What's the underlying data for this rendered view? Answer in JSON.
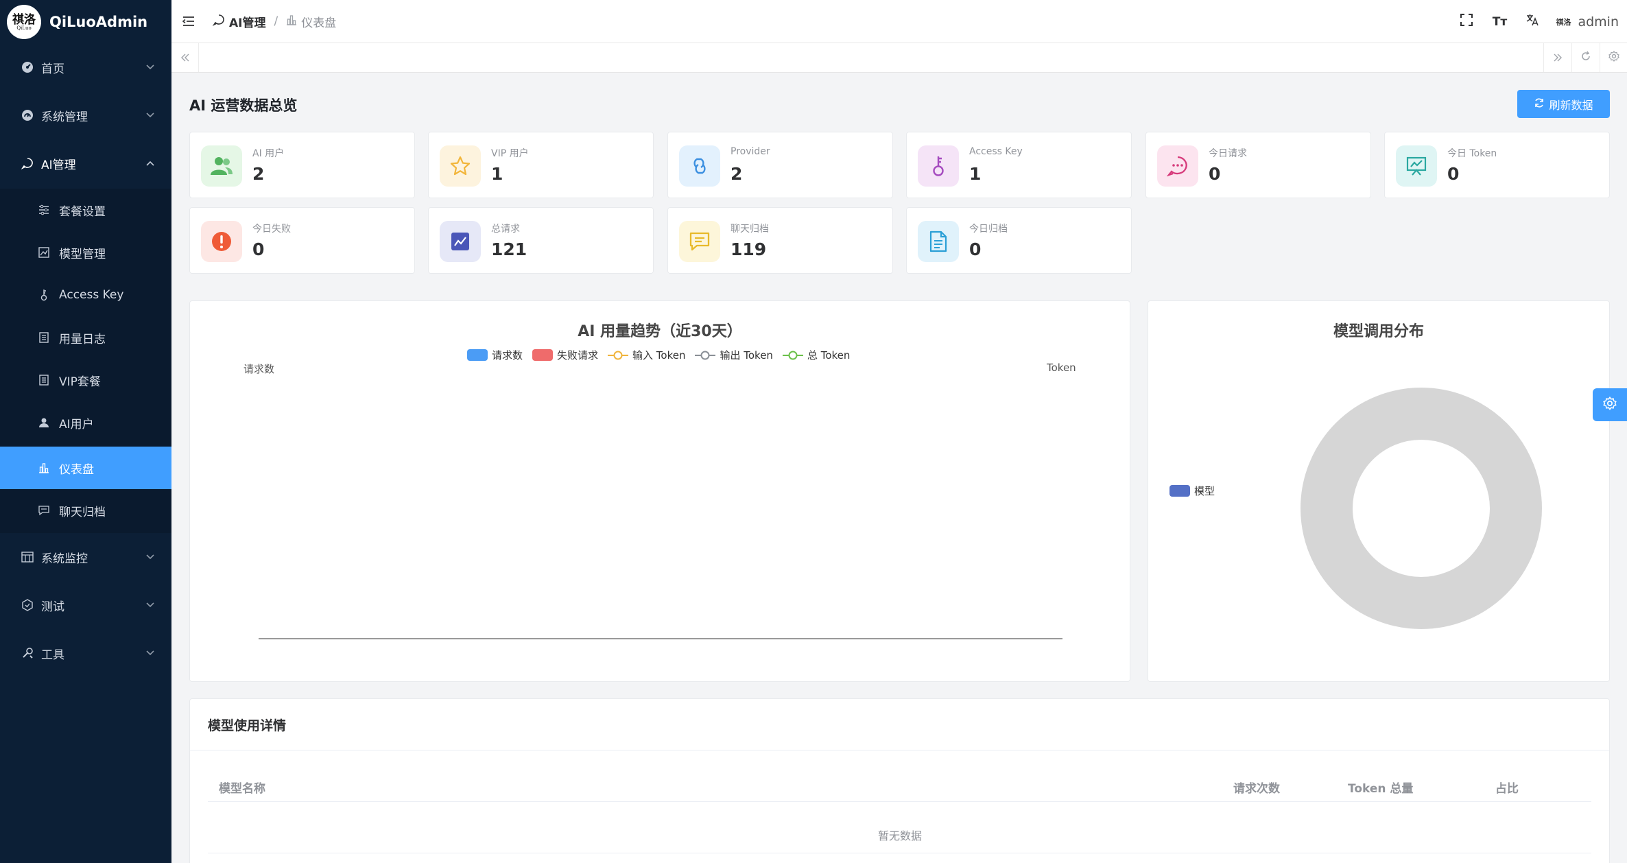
{
  "brand": {
    "logo_text": "祺洛",
    "logo_sub": "QiLuo",
    "name": "QiLuoAdmin"
  },
  "sidebar": {
    "top_items": [
      {
        "label": "首页",
        "icon": "dashboard-icon"
      },
      {
        "label": "系统管理",
        "icon": "gauge-icon"
      },
      {
        "label": "AI管理",
        "icon": "chat-bubble-icon",
        "expanded": true
      }
    ],
    "sub_items": [
      {
        "label": "套餐设置",
        "icon": "sliders-icon"
      },
      {
        "label": "模型管理",
        "icon": "image-chart-icon"
      },
      {
        "label": "Access Key",
        "icon": "key-icon"
      },
      {
        "label": "用量日志",
        "icon": "document-icon"
      },
      {
        "label": "VIP套餐",
        "icon": "document-icon"
      },
      {
        "label": "AI用户",
        "icon": "user-icon"
      },
      {
        "label": "仪表盘",
        "icon": "bar-chart-icon",
        "active": true
      },
      {
        "label": "聊天归档",
        "icon": "message-icon"
      }
    ],
    "bottom_items": [
      {
        "label": "系统监控",
        "icon": "monitor-icon"
      },
      {
        "label": "测试",
        "icon": "hexagon-icon"
      },
      {
        "label": "工具",
        "icon": "tools-icon"
      }
    ]
  },
  "header": {
    "breadcrumb": {
      "parent": "AI管理",
      "separator": "/",
      "current": "仪表盘"
    },
    "font_size_label": "Tт",
    "user_avatar_text": "祺洛",
    "username": "admin"
  },
  "page": {
    "title": "AI 运营数据总览",
    "refresh_label": "刷新数据"
  },
  "stats": [
    {
      "label": "AI 用户",
      "value": "2",
      "icon": "users-icon",
      "bg": "#e5f7e6",
      "fg": "#52b35f"
    },
    {
      "label": "VIP 用户",
      "value": "1",
      "icon": "star-icon",
      "bg": "#fdf3de",
      "fg": "#f2b53a"
    },
    {
      "label": "Provider",
      "value": "2",
      "icon": "link-icon",
      "bg": "#e3f1fd",
      "fg": "#3b8fe0"
    },
    {
      "label": "Access Key",
      "value": "1",
      "icon": "key-icon",
      "bg": "#f5e4f7",
      "fg": "#a54bbf"
    },
    {
      "label": "今日请求",
      "value": "0",
      "icon": "chat-dots-icon",
      "bg": "#fce4ef",
      "fg": "#d6397a"
    },
    {
      "label": "今日 Token",
      "value": "0",
      "icon": "presentation-chart-icon",
      "bg": "#dff5f4",
      "fg": "#2aa8a0"
    },
    {
      "label": "今日失败",
      "value": "0",
      "icon": "alert-icon",
      "bg": "#fde7e4",
      "fg": "#ef5b37"
    },
    {
      "label": "总请求",
      "value": "121",
      "icon": "trend-icon",
      "bg": "#e6e8f7",
      "fg": "#4a56b8"
    },
    {
      "label": "聊天归档",
      "value": "119",
      "icon": "message-icon",
      "bg": "#fdf6da",
      "fg": "#e8ba2a"
    },
    {
      "label": "今日归档",
      "value": "0",
      "icon": "file-text-icon",
      "bg": "#e0f2fb",
      "fg": "#2a9fd6"
    }
  ],
  "trend_chart": {
    "title": "AI 用量趋势（近30天）",
    "left_axis_name": "请求数",
    "right_axis_name": "Token",
    "legend": [
      {
        "name": "请求数",
        "type": "bar",
        "color": "#4b9cf5"
      },
      {
        "name": "失败请求",
        "type": "bar",
        "color": "#ef6b6b"
      },
      {
        "name": "输入 Token",
        "type": "line",
        "color": "#f0b43c"
      },
      {
        "name": "输出 Token",
        "type": "line",
        "color": "#8a8f96"
      },
      {
        "name": "总 Token",
        "type": "line",
        "color": "#6cc04a"
      }
    ]
  },
  "pie_chart": {
    "title": "模型调用分布",
    "legend": [
      {
        "name": "模型",
        "color": "#5470c6"
      }
    ],
    "empty_ring_color": "#d6d6d6"
  },
  "chart_data": [
    {
      "type": "line",
      "title": "AI 用量趋势（近30天）",
      "ylabel": "请求数",
      "y2label": "Token",
      "series": [
        {
          "name": "请求数",
          "values": []
        },
        {
          "name": "失败请求",
          "values": []
        },
        {
          "name": "输入 Token",
          "values": []
        },
        {
          "name": "输出 Token",
          "values": []
        },
        {
          "name": "总 Token",
          "values": []
        }
      ],
      "legend_position": "top-center"
    },
    {
      "type": "pie",
      "title": "模型调用分布",
      "series": [
        {
          "name": "模型",
          "values": []
        }
      ],
      "legend_position": "left"
    }
  ],
  "detail": {
    "title": "模型使用详情",
    "columns": [
      "模型名称",
      "请求次数",
      "Token 总量",
      "占比"
    ],
    "empty_text": "暂无数据"
  }
}
